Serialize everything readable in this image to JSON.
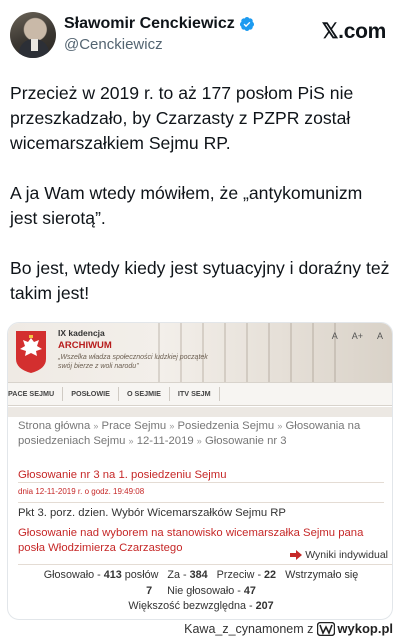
{
  "tweet": {
    "display_name": "Sławomir Cenckiewicz",
    "handle": "@Cenckiewicz",
    "platform_logo": "𝕏.com",
    "icons": {
      "verified": "verified-badge-icon",
      "logo": "x-logo-icon"
    },
    "accent_color": "#1d9bf0",
    "paragraphs": [
      "Przecież w 2019 r. to aż 177 posłom PiS nie przeszkadzało, by Czarzasty z PZPR został wicemarszałkiem Sejmu RP.",
      "A ja Wam wtedy mówiłem, że „antykomunizm jest sierotą”.",
      "Bo jest, wtedy kiedy jest sytuacyjny i doraźny też takim jest!"
    ]
  },
  "screenshot": {
    "kadencja": "IX kadencja",
    "archiwum": "ARCHIWUM",
    "motto": "„Wszelka władza społeczności ludzkiej początek swój bierze z woli narodu”",
    "font_controls": [
      "A",
      "A+",
      "A"
    ],
    "nav": [
      "PACE SEJMU",
      "POSŁOWIE",
      "O SEJMIE",
      "ITV SEJM"
    ],
    "breadcrumb": [
      "Strona główna",
      "Prace Sejmu",
      "Posiedzenia Sejmu",
      "Głosowania na posiedzeniach Sejmu",
      "12-11-2019",
      "Głosowanie nr 3"
    ],
    "breadcrumb_separator": "»",
    "vote_title": "Głosowanie nr 3 na 1. posiedzeniu Sejmu",
    "vote_date": "dnia 12-11-2019 r. o godz. 19:49:08",
    "pkt": "Pkt 3. porz. dzien. Wybór Wicemarszałków Sejmu RP",
    "subject": "Głosowanie nad wyborem na stanowisko wicemarszałka Sejmu pana posła Włodzimierza Czarzastego",
    "results_link": "Wyniki indywidual",
    "results_icon": "arrow-right-icon",
    "accent_red": "#c62828",
    "tally": {
      "glosowalo_label": "Głosowało",
      "glosowalo": "413",
      "poslow": "posłów",
      "za_label": "Za",
      "za": "384",
      "przeciw_label": "Przeciw",
      "przeciw": "22",
      "wstrzymalo_label": "Wstrzymało się",
      "wstrzymalo": "7",
      "nie_glosowalo_label": "Nie głosowało",
      "nie_glosowalo": "47",
      "wiekszosc_label": "Większość bezwzględna",
      "wiekszosc": "207",
      "dash": "-"
    }
  },
  "watermark": {
    "user": "Kawa_z_cynamonem",
    "z": "z",
    "site": "wykop.pl"
  }
}
